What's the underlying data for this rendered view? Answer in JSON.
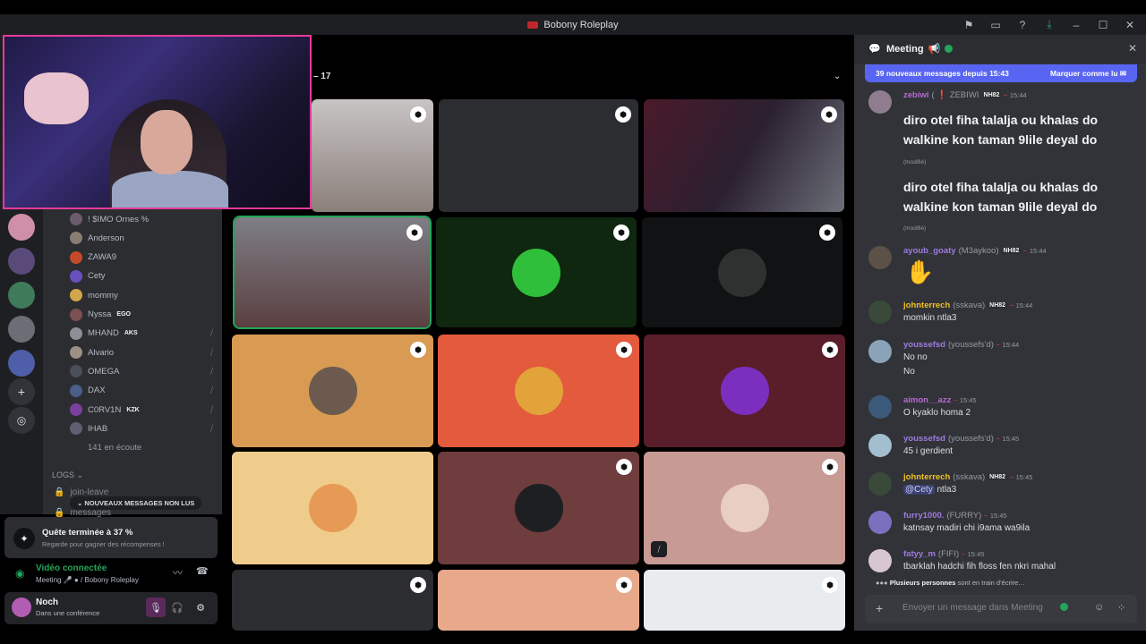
{
  "window": {
    "title": "Bobony Roleplay"
  },
  "stage": {
    "count": "– 17"
  },
  "members": [
    {
      "name": "! $IMO Ornes %",
      "color": "#b5bac1"
    },
    {
      "name": "Anderson",
      "color": "#b5bac1"
    },
    {
      "name": "ZAWA9",
      "color": "#b5bac1"
    },
    {
      "name": "Cety",
      "color": "#b5bac1"
    },
    {
      "name": "mommy",
      "color": "#b5bac1"
    },
    {
      "name": "Nyssa",
      "color": "#b5bac1",
      "tag": "EGO"
    },
    {
      "name": "MHAND",
      "color": "#b5bac1",
      "tag": "AKS"
    },
    {
      "name": "Alvario",
      "color": "#b5bac1"
    },
    {
      "name": "OMEGA",
      "color": "#b5bac1"
    },
    {
      "name": "DAX",
      "color": "#b5bac1"
    },
    {
      "name": "C0RV1N",
      "color": "#b5bac1",
      "tag": "KZK"
    },
    {
      "name": "IHAB",
      "color": "#b5bac1"
    },
    {
      "name": "141 en écoute",
      "color": "#949ba4"
    }
  ],
  "channels": {
    "logs": "LOGS",
    "join_leave": "join-leave",
    "messages": "messages",
    "new_messages_pill": "NOUVEAUX MESSAGES NON LUS"
  },
  "quest": {
    "title": "Quête terminée à 37 %",
    "sub": "Regarde pour gagner des récompenses !"
  },
  "voice": {
    "status": "Vidéo connectée",
    "location": "Meeting",
    "server": "/ Bobony Roleplay"
  },
  "user": {
    "name": "Noch",
    "status": "Dans une conférence"
  },
  "chat": {
    "channel": "Meeting",
    "banner_text": "39 nouveaux messages depuis 15:43",
    "banner_action": "Marquer comme lu",
    "messages": [
      {
        "name": "zebiwi",
        "alt": "( ❗ ZEBIWI",
        "tag": "NH82",
        "time": "15:44",
        "color": "#b66bd1"
      },
      {
        "name": "ayoub_goaty",
        "alt": "(M3aykoo)",
        "tag": "NH82",
        "time": "15:44",
        "color": "#9f7be0"
      },
      {
        "name": "johnterrech",
        "alt": "(sskava)",
        "tag": "NH82",
        "time": "15:44",
        "color": "#f0c020",
        "body": "momkin ntla3"
      },
      {
        "name": "youssefsd",
        "alt": "(youssefs'd)",
        "time": "15:44",
        "color": "#9f7be0",
        "body": "No no",
        "body2": "No"
      },
      {
        "name": "aimon__azz",
        "alt": "",
        "time": "15:45",
        "color": "#b66bd1",
        "body": "O kyaklo homa 2"
      },
      {
        "name": "youssefsd",
        "alt": "(youssefs'd)",
        "time": "15:45",
        "color": "#9f7be0",
        "body": "45 i gerdient"
      },
      {
        "name": "johnterrech",
        "alt": "(sskava)",
        "tag": "NH82",
        "time": "15:45",
        "color": "#f0c020",
        "mention": "@Cety",
        "body": "ntla3"
      },
      {
        "name": "furry1000.",
        "alt": "(FURRY)",
        "time": "15:45",
        "color": "#9f7be0",
        "body": "katnsay madiri chi i9ama wa9ila"
      },
      {
        "name": "fatyy_m",
        "alt": "(FIFI)",
        "time": "15:45",
        "color": "#9f7be0",
        "body": "tbarklah hadchi fih floss fen nkri mahal"
      }
    ],
    "big_text": "diro otel fiha talalja ou khalas do walkine kon taman 9lile deyal do",
    "edited": "(modifié)",
    "typing_who": "Plusieurs personnes",
    "typing_rest": "sont en train d'écrire…",
    "composer_placeholder": "Envoyer un message dans Meeting"
  },
  "colors": {
    "accent": "#5865f2",
    "online": "#23a55a",
    "pink": "#e73a9a"
  }
}
